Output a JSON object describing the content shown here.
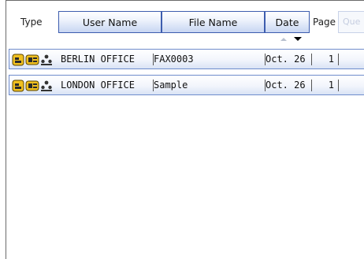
{
  "header": {
    "type_label": "Type",
    "user_name_label": "User Name",
    "file_name_label": "File Name",
    "date_label": "Date",
    "page_label": "Page",
    "queue_label": "Que"
  },
  "rows": [
    {
      "icons": [
        "memory-tx-icon",
        "fax-icon",
        "users-icon"
      ],
      "user": "BERLIN OFFICE",
      "file": "FAX0003",
      "date": "Oct. 26",
      "pages": "1"
    },
    {
      "icons": [
        "memory-tx-icon",
        "fax-icon",
        "users-icon"
      ],
      "user": "LONDON OFFICE",
      "file": "Sample",
      "date": "Oct. 26",
      "pages": "1"
    }
  ],
  "colors": {
    "header_border": "#3d5dae",
    "row_border": "#6f8ccc",
    "icon_yellow": "#f0c020"
  }
}
